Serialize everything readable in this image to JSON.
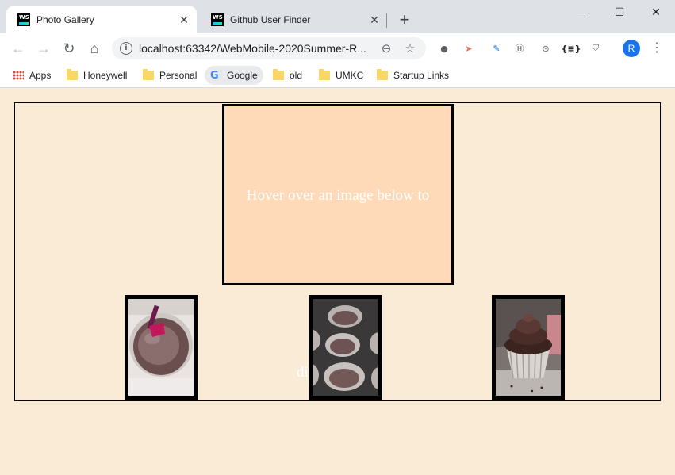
{
  "browser": {
    "tabs": [
      {
        "title": "Photo Gallery",
        "favicon": "WS",
        "active": true
      },
      {
        "title": "Github User Finder",
        "favicon": "WS",
        "active": false
      }
    ],
    "new_tab_label": "+",
    "url": "localhost:63342/WebMobile-2020Summer-R...",
    "avatar_initial": "R",
    "window_controls": {
      "minimize": "—",
      "maximize": "☐",
      "close": "✕"
    }
  },
  "bookmarks": [
    {
      "label": "Apps",
      "icon": "apps-grid-icon"
    },
    {
      "label": "Honeywell",
      "icon": "folder-icon"
    },
    {
      "label": "Personal",
      "icon": "folder-icon"
    },
    {
      "label": "Google",
      "icon": "google-icon"
    },
    {
      "label": "old",
      "icon": "folder-icon"
    },
    {
      "label": "UMKC",
      "icon": "folder-icon"
    },
    {
      "label": "Startup Links",
      "icon": "folder-icon"
    }
  ],
  "gallery": {
    "main_text": "Hover over an image below to",
    "overflow_text": "di",
    "main_bg_color": "#ffdab9",
    "page_bg_color": "#faebd7",
    "thumbnails": [
      {
        "subject": "chocolate batter with spatula"
      },
      {
        "subject": "cupcake tin with batter"
      },
      {
        "subject": "chocolate frosted cupcake"
      }
    ]
  }
}
